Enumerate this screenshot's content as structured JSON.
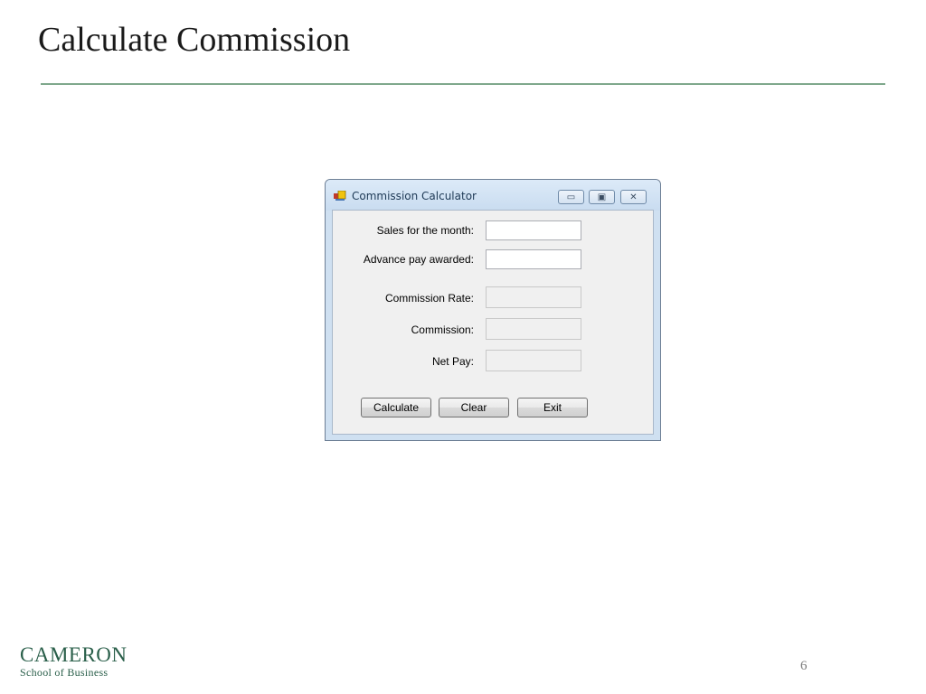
{
  "slide": {
    "title": "Calculate Commission",
    "page_number": "6",
    "logo": {
      "line1": "CAMERON",
      "line2": "School of Business"
    }
  },
  "window": {
    "title": "Commission Calculator",
    "caption_buttons": {
      "minimize": "▭",
      "maximize": "▣",
      "close": "✕"
    },
    "fields": [
      {
        "label": "Sales for the month:",
        "value": "",
        "editable": true
      },
      {
        "label": "Advance pay awarded:",
        "value": "",
        "editable": true
      },
      {
        "label": "Commission Rate:",
        "value": "",
        "editable": false
      },
      {
        "label": "Commission:",
        "value": "",
        "editable": false
      },
      {
        "label": "Net Pay:",
        "value": "",
        "editable": false
      }
    ],
    "buttons": {
      "calculate": "Calculate",
      "clear": "Clear",
      "exit": "Exit"
    }
  },
  "colors": {
    "title_rule": "#7fa88c",
    "logo": "#2a5f4a",
    "window_frame": "#cfe0f1"
  },
  "icons": {
    "app": "app-icon",
    "minimize": "minimize-icon",
    "maximize": "maximize-icon",
    "close": "close-icon"
  }
}
